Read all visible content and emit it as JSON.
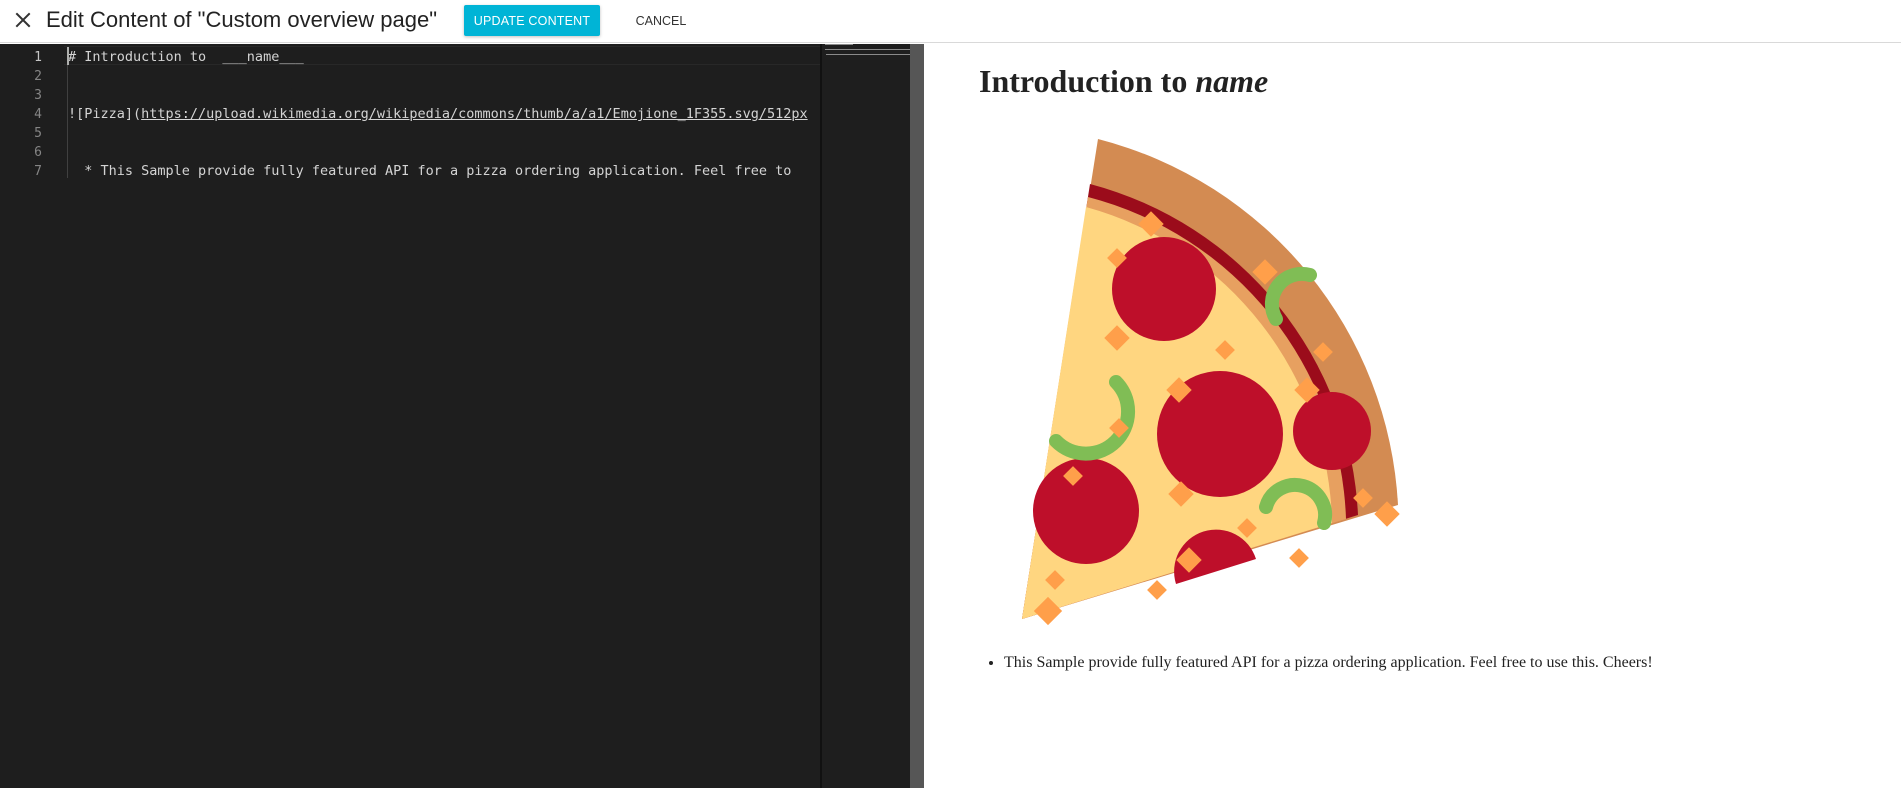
{
  "header": {
    "title": "Edit Content of \"Custom overview page\"",
    "update_label": "UPDATE CONTENT",
    "cancel_label": "CANCEL"
  },
  "editor": {
    "active_line": 1,
    "lines": [
      {
        "num": "1",
        "text": "# Introduction to  ___name___"
      },
      {
        "num": "2",
        "text": ""
      },
      {
        "num": "3",
        "text": ""
      },
      {
        "num": "4",
        "prefix": "![Pizza](",
        "link": "https://upload.wikimedia.org/wikipedia/commons/thumb/a/a1/Emojione_1F355.svg/512px"
      },
      {
        "num": "5",
        "text": ""
      },
      {
        "num": "6",
        "text": ""
      },
      {
        "num": "7",
        "text": "  * This Sample provide fully featured API for a pizza ordering application. Feel free to"
      }
    ]
  },
  "preview": {
    "heading_prefix": "Introduction to ",
    "heading_em": "name",
    "image_alt": "Pizza",
    "bullets": [
      "This Sample provide fully featured API for a pizza ordering application. Feel free to use this. Cheers!"
    ]
  },
  "colors": {
    "accent": "#00b4d6",
    "editor_bg": "#1e1e1e",
    "crust": "#d38b52",
    "cheese": "#ffd680",
    "pepperoni": "#be0f2a",
    "pepper": "#80bd55"
  },
  "icons": {
    "close": "close-icon",
    "pizza": "pizza-image"
  }
}
